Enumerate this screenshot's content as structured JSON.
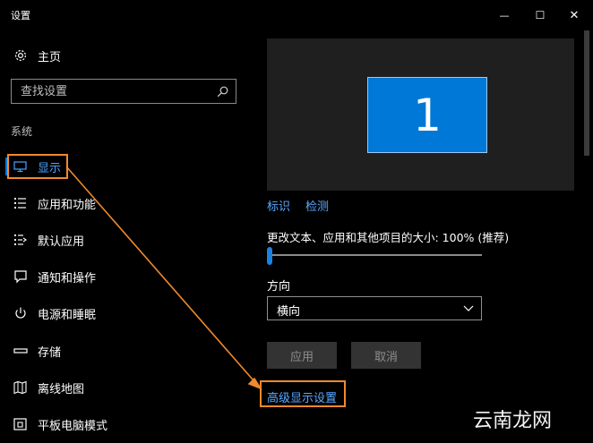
{
  "window": {
    "title": "设置",
    "minimize_glyph": "—",
    "maximize_glyph": "☐",
    "close_glyph": "✕"
  },
  "sidebar": {
    "home_label": "主页",
    "search_placeholder": "查找设置",
    "section_title": "系统",
    "items": [
      {
        "label": "显示",
        "icon": "monitor-icon",
        "selected": true
      },
      {
        "label": "应用和功能",
        "icon": "apps-list-icon"
      },
      {
        "label": "默认应用",
        "icon": "default-apps-icon"
      },
      {
        "label": "通知和操作",
        "icon": "notification-icon"
      },
      {
        "label": "电源和睡眠",
        "icon": "power-icon"
      },
      {
        "label": "存储",
        "icon": "storage-icon"
      },
      {
        "label": "离线地图",
        "icon": "map-icon"
      },
      {
        "label": "平板电脑模式",
        "icon": "tablet-mode-icon"
      }
    ]
  },
  "main": {
    "monitor_number": "1",
    "identify_link": "标识",
    "detect_link": "检测",
    "scale_label": "更改文本、应用和其他项目的大小: 100% (推荐)",
    "scale_slider_fraction": 0,
    "orientation_label": "方向",
    "orientation_value": "横向",
    "apply_button": "应用",
    "cancel_button": "取消",
    "advanced_link": "高级显示设置"
  },
  "watermark": "云南龙网",
  "colors": {
    "background": "#000000",
    "accent": "#0078d7",
    "link": "#5aa8ff",
    "annotation": "#f08a2c"
  }
}
